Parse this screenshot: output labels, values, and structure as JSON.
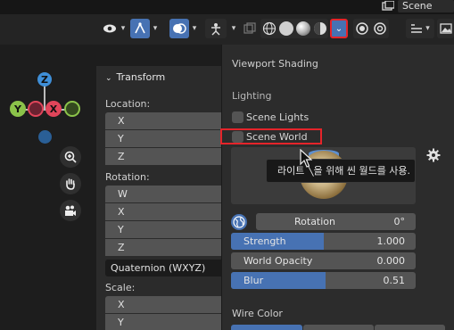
{
  "topbar": {
    "scene_label": "Scene"
  },
  "header": {
    "items": [
      "view-icon",
      "gizmo-icon",
      "overlay-icon",
      "snapping-icon",
      "xray-icon",
      "wireframe-shading",
      "solid-shading",
      "material-shading",
      "rendered-shading",
      "shading-options",
      "render-pass",
      "editor-type"
    ]
  },
  "viewport": {
    "axes": {
      "z": "Z",
      "y": "Y",
      "x": "X"
    }
  },
  "transform": {
    "title": "Transform",
    "location_label": "Location:",
    "location_fields": [
      "X",
      "Y",
      "Z"
    ],
    "rotation_label": "Rotation:",
    "rotation_fields": [
      "W",
      "X",
      "Y",
      "Z"
    ],
    "rotation_mode": "Quaternion (WXYZ)",
    "scale_label": "Scale:",
    "scale_fields": [
      "X",
      "Y"
    ]
  },
  "popover": {
    "title": "Viewport Shading",
    "lighting_label": "Lighting",
    "scene_lights_label": "Scene Lights",
    "scene_world_label": "Scene World",
    "tooltip": "라이트 ╲을 위해 씬 월드를 사용.",
    "rotation": {
      "label": "Rotation",
      "value": "0°"
    },
    "strength": {
      "label": "Strength",
      "value": "1.000",
      "fill": 0.5
    },
    "world_opacity": {
      "label": "World Opacity",
      "value": "0.000",
      "fill": 0.0
    },
    "blur": {
      "label": "Blur",
      "value": "0.51",
      "fill": 0.51
    },
    "wire_color_label": "Wire Color"
  },
  "colors": {
    "accent_blue": "#4772b3",
    "highlight_red": "#e5242a",
    "axis_x": "#e0455a",
    "axis_y": "#8bc34a",
    "axis_z": "#3f8fd8"
  }
}
